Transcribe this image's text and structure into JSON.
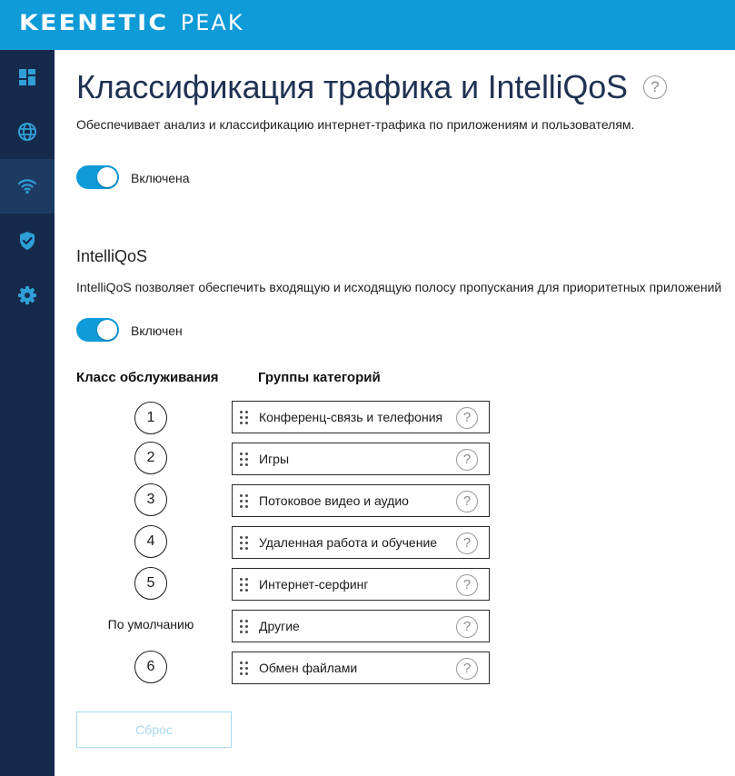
{
  "header": {
    "logo_brand": "KEENETIC",
    "logo_model": "PEAK",
    "brand_color": "#0f9ad8"
  },
  "sidebar": {
    "items": [
      {
        "icon": "dashboard-icon"
      },
      {
        "icon": "globe-icon"
      },
      {
        "icon": "wifi-icon",
        "active": true
      },
      {
        "icon": "shield-icon"
      },
      {
        "icon": "gear-icon"
      }
    ],
    "bg_color": "#152a4b"
  },
  "page": {
    "title": "Классификация трафика и IntelliQoS",
    "title_help": "?",
    "description": "Обеспечивает анализ и классификацию интернет-трафика по приложениям и пользователям.",
    "classification_toggle": {
      "label": "Включена",
      "on": true
    }
  },
  "intelliqos": {
    "title": "IntelliQoS",
    "description": "IntelliQoS позволяет обеспечить входящую и исходящую полосу пропускания для приоритетных приложений",
    "toggle": {
      "label": "Включен",
      "on": true
    },
    "col_class": "Класс обслуживания",
    "col_groups": "Группы категорий",
    "rows": [
      {
        "class": "1",
        "group": "Конференц-связь и телефония",
        "help": "?"
      },
      {
        "class": "2",
        "group": "Игры",
        "help": "?"
      },
      {
        "class": "3",
        "group": "Потоковое видео и аудио",
        "help": "?"
      },
      {
        "class": "4",
        "group": "Удаленная работа и обучение",
        "help": "?"
      },
      {
        "class": "5",
        "group": "Интернет-серфинг",
        "help": "?"
      },
      {
        "class": "По умолчанию",
        "group": "Другие",
        "help": "?"
      },
      {
        "class": "6",
        "group": "Обмен файлами",
        "help": "?"
      }
    ],
    "reset_label": "Сброс"
  }
}
